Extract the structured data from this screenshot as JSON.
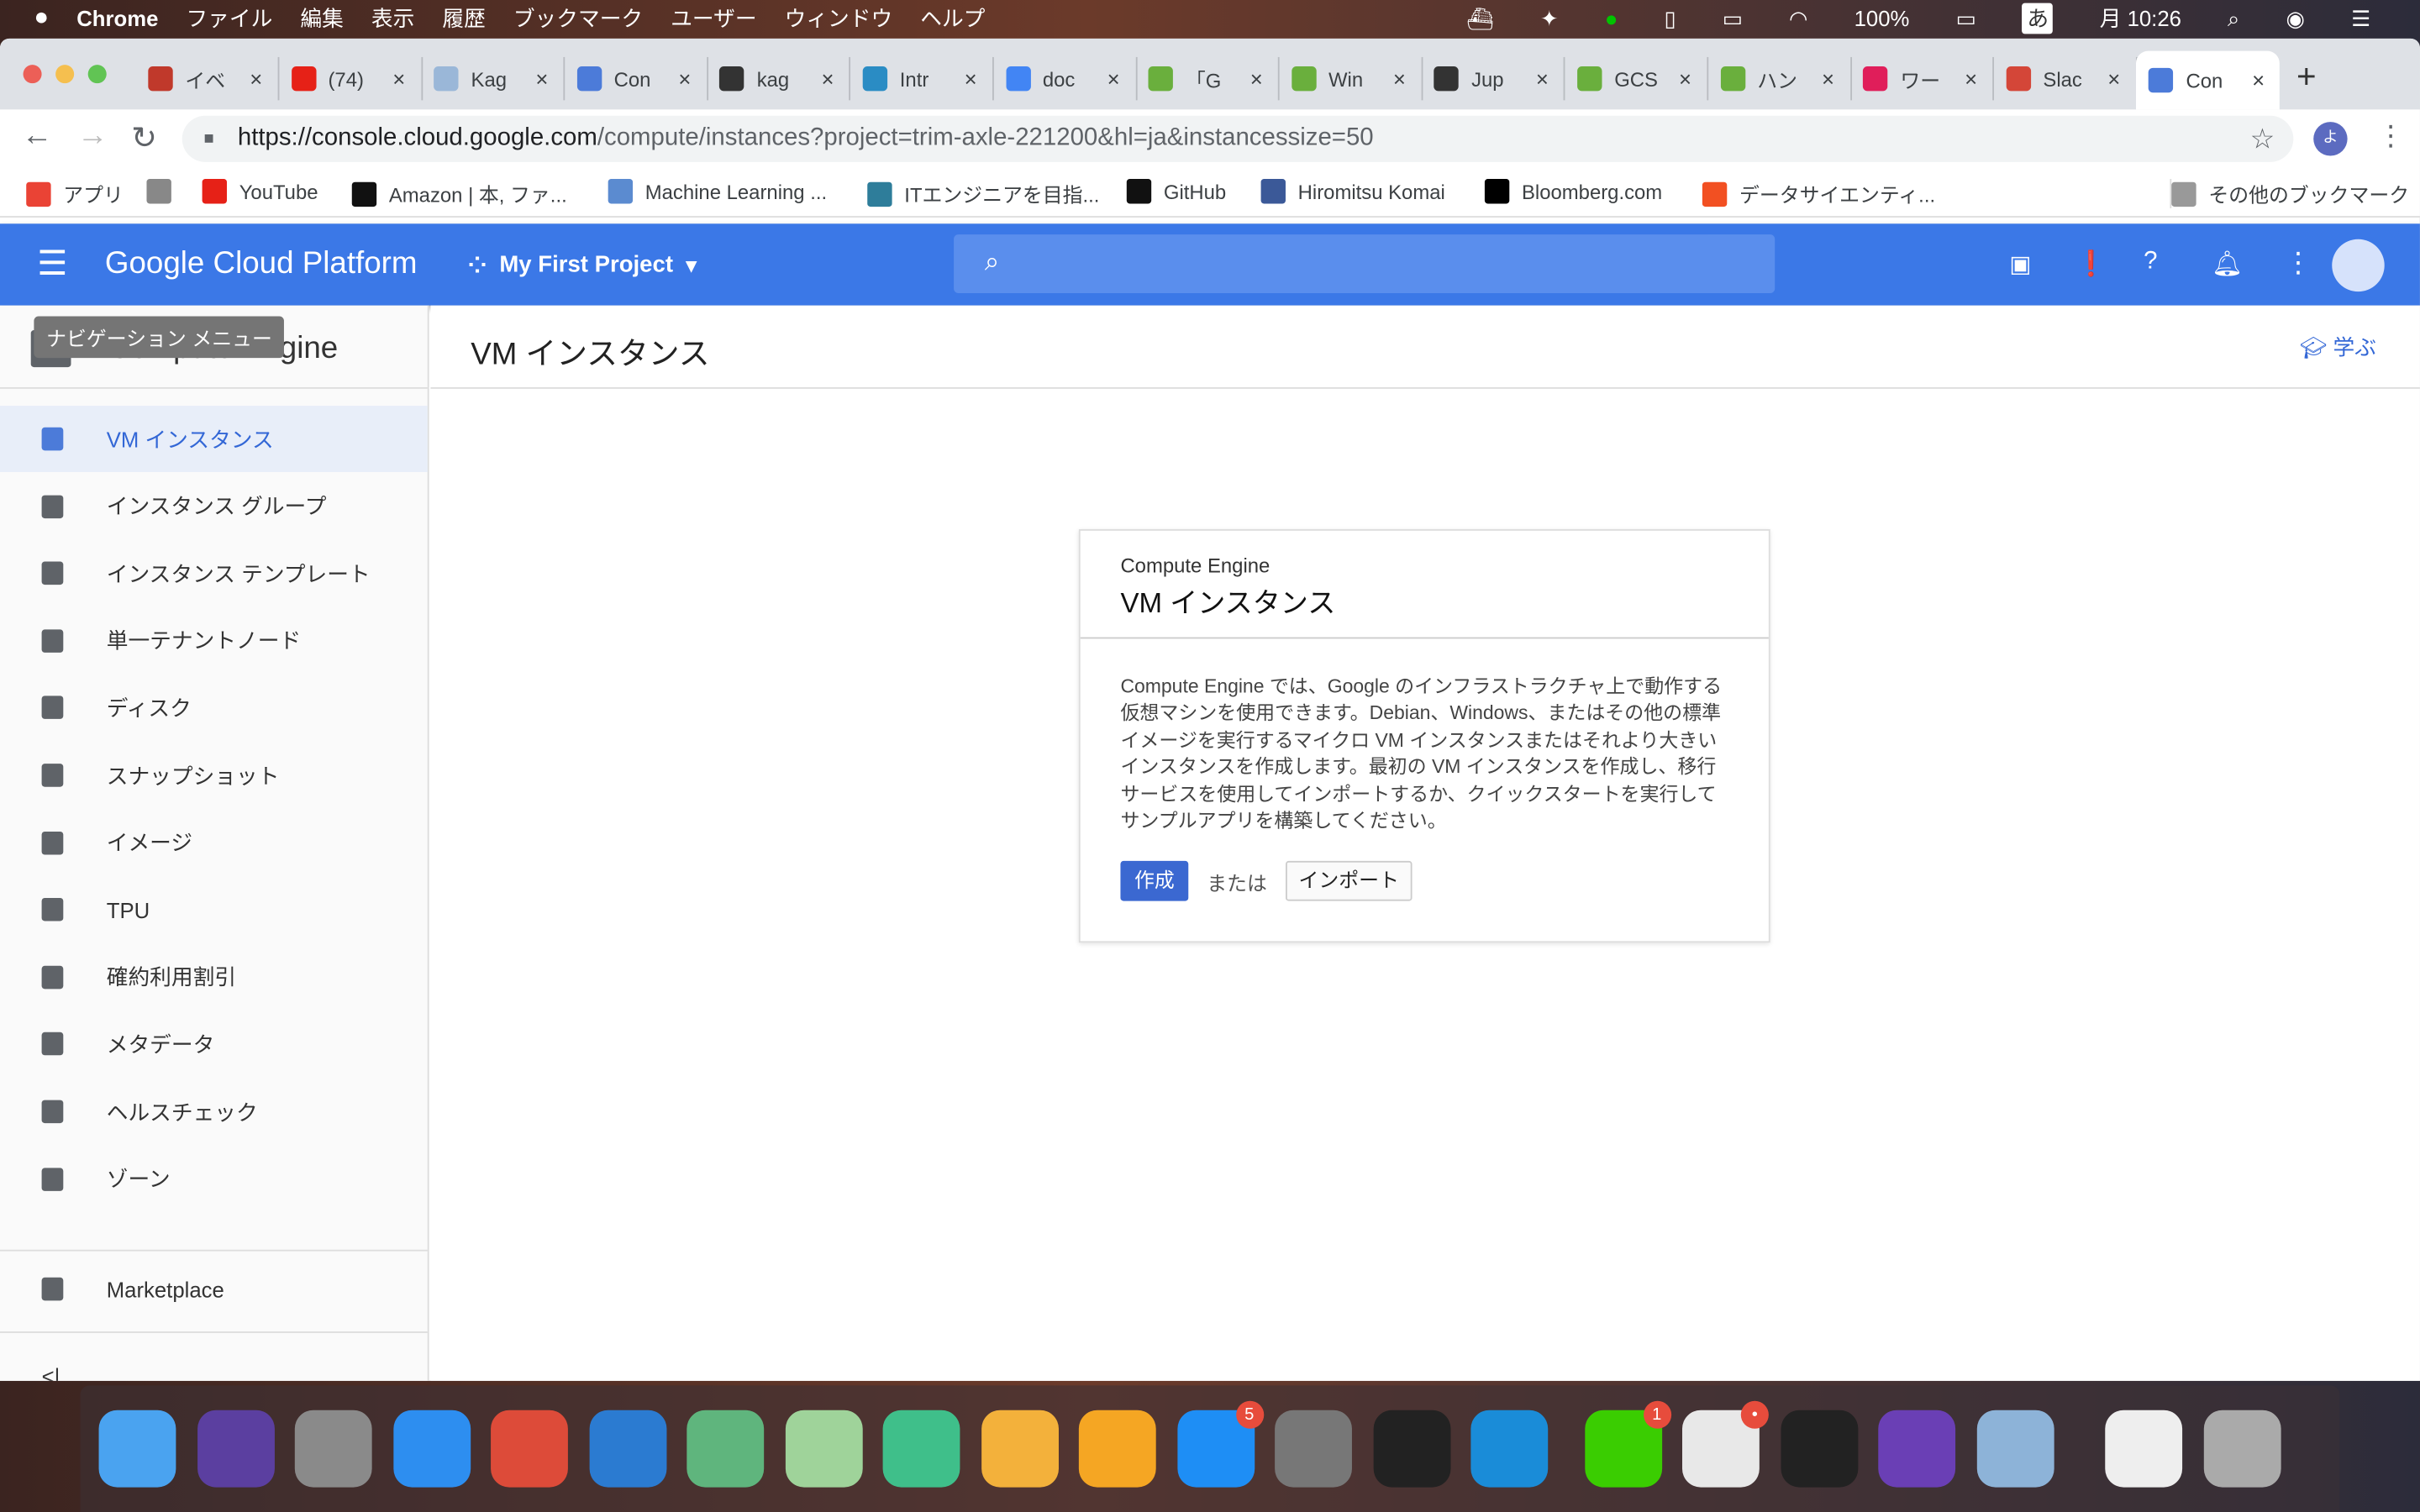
{
  "menubar": {
    "app": "Chrome",
    "items": [
      "ファイル",
      "編集",
      "表示",
      "履歴",
      "ブックマーク",
      "ユーザー",
      "ウィンドウ",
      "ヘルプ"
    ],
    "battery": "100%",
    "ime": "あ",
    "clock": "月 10:26"
  },
  "tabs": [
    {
      "label": "イベ",
      "color": "#c0392b"
    },
    {
      "label": "(74)",
      "color": "#e62117"
    },
    {
      "label": "Kag",
      "color": "#9ab7d8"
    },
    {
      "label": "Con",
      "color": "#4c7bd9"
    },
    {
      "label": "kag",
      "color": "#333333"
    },
    {
      "label": "Intr",
      "color": "#2a8cc4"
    },
    {
      "label": "doc",
      "color": "#4285f4"
    },
    {
      "label": "「G",
      "color": "#6aaf3d"
    },
    {
      "label": "Win",
      "color": "#6aaf3d"
    },
    {
      "label": "Jup",
      "color": "#333333"
    },
    {
      "label": "GCS",
      "color": "#6aaf3d"
    },
    {
      "label": "ハン",
      "color": "#6aaf3d"
    },
    {
      "label": "ワー",
      "color": "#e01e5a"
    },
    {
      "label": "Slac",
      "color": "#d44638"
    },
    {
      "label": "Con",
      "color": "#4c7bd9",
      "active": true
    }
  ],
  "address": {
    "host": "https://console.cloud.google.com",
    "path": "/compute/instances?project=trim-axle-221200&hl=ja&instancessize=50"
  },
  "profile_initial": "よ",
  "bookmarks": [
    {
      "label": "アプリ",
      "color": "#ea4335"
    },
    {
      "label": "",
      "color": "#888888"
    },
    {
      "label": "YouTube",
      "color": "#e62117"
    },
    {
      "label": "Amazon | 本, ファ...",
      "color": "#111111"
    },
    {
      "label": "Machine Learning ...",
      "color": "#5b8bd0"
    },
    {
      "label": "ITエンジニアを目指...",
      "color": "#2e7d9a"
    },
    {
      "label": "GitHub",
      "color": "#111111"
    },
    {
      "label": "Hiromitsu Komai",
      "color": "#3b5998"
    },
    {
      "label": "Bloomberg.com",
      "color": "#000000"
    },
    {
      "label": "データサイエンティ...",
      "color": "#f25022"
    }
  ],
  "other_bookmarks": "その他のブックマーク",
  "gcp": {
    "title": "Google Cloud Platform",
    "project": "My First Project",
    "accent": "#3b78e7"
  },
  "sidebar": {
    "product": "Compute Engine",
    "tooltip": "ナビゲーション メニュー",
    "items": [
      {
        "label": "VM インスタンス",
        "icon": "vm-instance-icon",
        "active": true
      },
      {
        "label": "インスタンス グループ",
        "icon": "instance-group-icon"
      },
      {
        "label": "インスタンス テンプレート",
        "icon": "template-icon"
      },
      {
        "label": "単一テナントノード",
        "icon": "sole-tenant-icon"
      },
      {
        "label": "ディスク",
        "icon": "disk-icon"
      },
      {
        "label": "スナップショット",
        "icon": "snapshot-icon"
      },
      {
        "label": "イメージ",
        "icon": "image-icon"
      },
      {
        "label": "TPU",
        "icon": "tpu-icon"
      },
      {
        "label": "確約利用割引",
        "icon": "discount-icon"
      },
      {
        "label": "メタデータ",
        "icon": "metadata-icon"
      },
      {
        "label": "ヘルスチェック",
        "icon": "health-check-icon"
      },
      {
        "label": "ゾーン",
        "icon": "zone-icon"
      }
    ],
    "marketplace": "Marketplace",
    "collapse": "<|"
  },
  "main": {
    "title": "VM インスタンス",
    "learn": "学ぶ",
    "card": {
      "eyebrow": "Compute Engine",
      "title": "VM インスタンス",
      "body": "Compute Engine では、Google のインフラストラクチャ上で動作する仮想マシンを使用できます。Debian、Windows、またはその他の標準イメージを実行するマイクロ VM インスタンスまたはそれより大きいインスタンスを作成します。最初の VM インスタンスを作成し、移行サービスを使用してインポートするか、クイックスタートを実行してサンプルアプリを構築してください。",
      "create": "作成",
      "or": "または",
      "import": "インポート"
    }
  },
  "dock": [
    {
      "name": "finder",
      "color": "#4aa3f0"
    },
    {
      "name": "siri",
      "color": "#5b3fa0"
    },
    {
      "name": "launchpad",
      "color": "#8a8a8a"
    },
    {
      "name": "safari",
      "color": "#2d8ef0"
    },
    {
      "name": "chrome",
      "color": "#dd4b39"
    },
    {
      "name": "vscode",
      "color": "#2b7bd1"
    },
    {
      "name": "atom",
      "color": "#5fb57d"
    },
    {
      "name": "maps",
      "color": "#9fd39a"
    },
    {
      "name": "send",
      "color": "#3fbf8a"
    },
    {
      "name": "photos",
      "color": "#f3b13b"
    },
    {
      "name": "pages",
      "color": "#f5a623"
    },
    {
      "name": "app-store",
      "color": "#1e8ef5",
      "badge": "5"
    },
    {
      "name": "system-preferences",
      "color": "#777777"
    },
    {
      "name": "terminal",
      "color": "#222222"
    },
    {
      "name": "kindle",
      "color": "#1a8cd8"
    },
    {
      "name": "line",
      "color": "#3acd01",
      "badge": "1"
    },
    {
      "name": "slack",
      "color": "#e8e8e8",
      "badge": "•"
    },
    {
      "name": "activity-monitor",
      "color": "#222222"
    },
    {
      "name": "vpn",
      "color": "#6a3fb5"
    },
    {
      "name": "preview",
      "color": "#8db3d8"
    },
    {
      "name": "chrome-window",
      "color": "#eeeeee"
    },
    {
      "name": "trash",
      "color": "#aaaaaa"
    }
  ]
}
